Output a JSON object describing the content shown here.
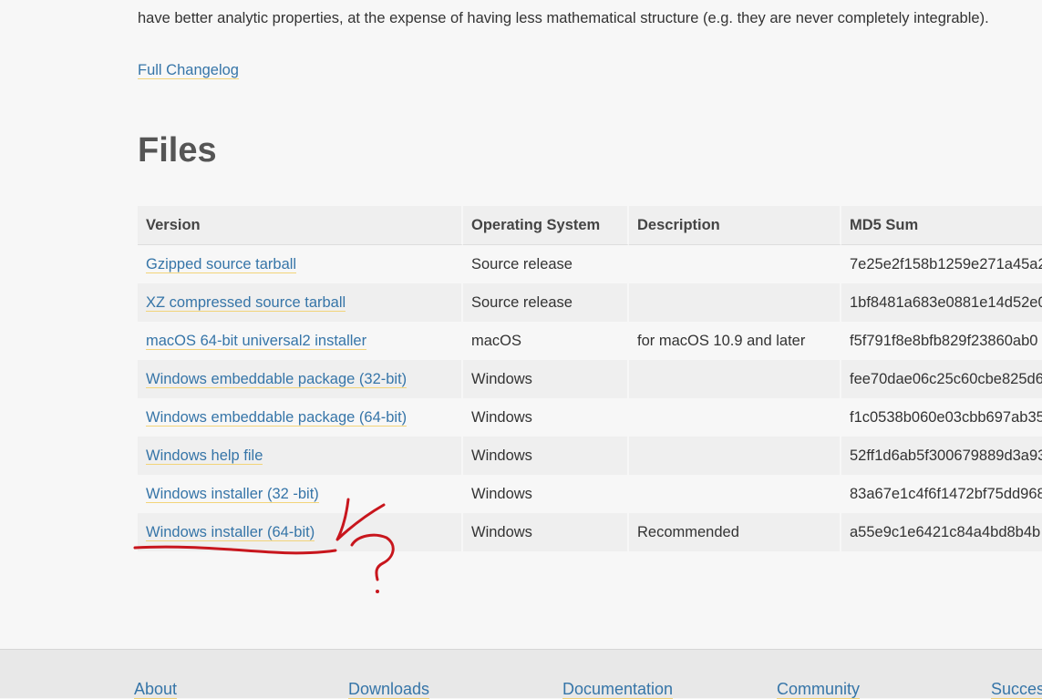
{
  "intro_text": "have better analytic properties, at the expense of having less mathematical structure (e.g. they are never completely integrable).",
  "changelog_link": "Full Changelog",
  "files_heading": "Files",
  "table": {
    "headers": [
      "Version",
      "Operating System",
      "Description",
      "MD5 Sum"
    ],
    "rows": [
      {
        "version": "Gzipped source tarball",
        "os": "Source release",
        "description": "",
        "md5": "7e25e2f158b1259e271a45a2"
      },
      {
        "version": "XZ compressed source tarball",
        "os": "Source release",
        "description": "",
        "md5": "1bf8481a683e0881e14d52e0"
      },
      {
        "version": "macOS 64-bit universal2 installer",
        "os": "macOS",
        "description": "for macOS 10.9 and later",
        "md5": "f5f791f8e8bfb829f23860ab0"
      },
      {
        "version": "Windows embeddable package (32-bit)",
        "os": "Windows",
        "description": "",
        "md5": "fee70dae06c25c60cbe825d6"
      },
      {
        "version": "Windows embeddable package (64-bit)",
        "os": "Windows",
        "description": "",
        "md5": "f1c0538b060e03cbb697ab35"
      },
      {
        "version": "Windows help file",
        "os": "Windows",
        "description": "",
        "md5": "52ff1d6ab5f300679889d3a93"
      },
      {
        "version": "Windows installer (32 -bit)",
        "os": "Windows",
        "description": "",
        "md5": "83a67e1c4f6f1472bf75dd968"
      },
      {
        "version": "Windows installer (64-bit)",
        "os": "Windows",
        "description": "Recommended",
        "md5": "a55e9c1e6421c84a4bd8b4b"
      }
    ]
  },
  "footer": {
    "links": [
      "About",
      "Downloads",
      "Documentation",
      "Community",
      "Succes"
    ]
  },
  "annotation": {
    "color": "#c8161d",
    "mark": "?"
  }
}
